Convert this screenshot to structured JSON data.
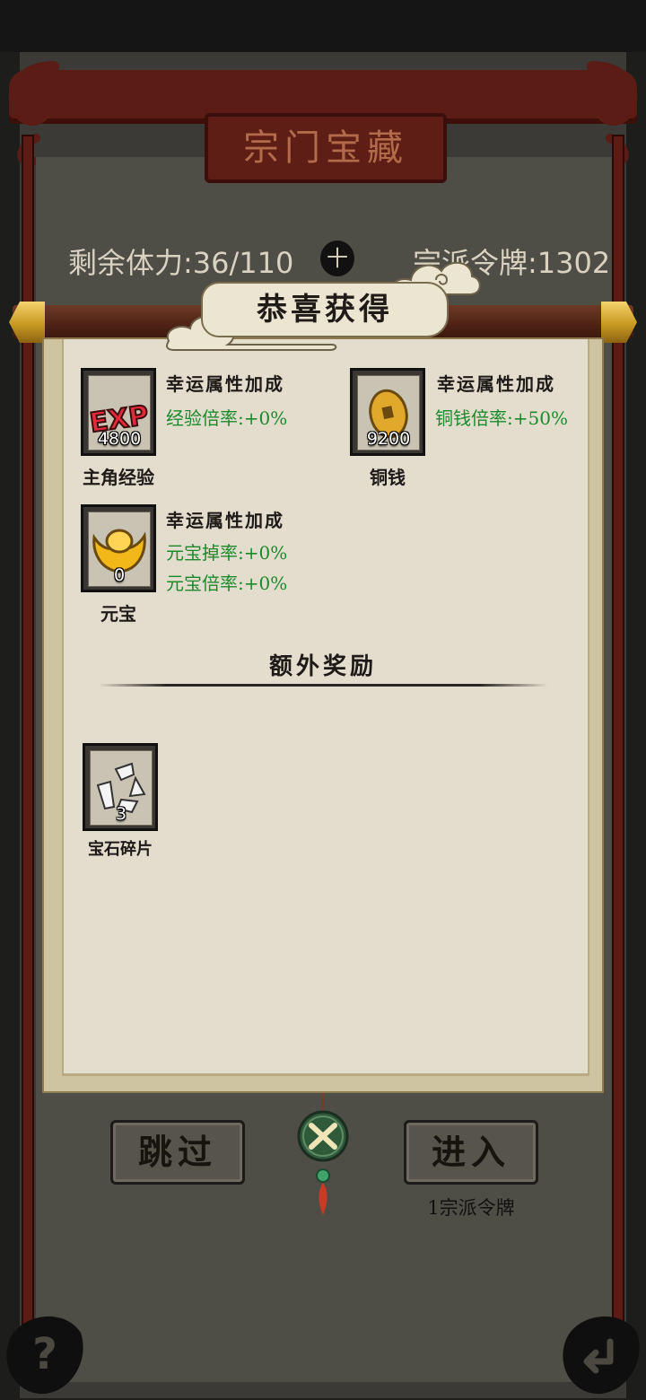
{
  "window": {
    "title": "宗门宝藏"
  },
  "stats": {
    "stamina_label": "剩余体力:36/110",
    "add_symbol": "十",
    "token_label": "宗派令牌:1302"
  },
  "reward_panel": {
    "title": "恭喜获得",
    "items": [
      {
        "name": "主角经验",
        "count": "4800",
        "icon": "exp-icon",
        "bonus_title": "幸运属性加成",
        "bonus_lines": [
          "经验倍率:+0%"
        ]
      },
      {
        "name": "铜钱",
        "count": "9200",
        "icon": "copper-coin-icon",
        "bonus_title": "幸运属性加成",
        "bonus_lines": [
          "铜钱倍率:+50%"
        ]
      },
      {
        "name": "元宝",
        "count": "0",
        "icon": "gold-ingot-icon",
        "bonus_title": "幸运属性加成",
        "bonus_lines": [
          "元宝掉率:+0%",
          "元宝倍率:+0%"
        ]
      }
    ],
    "extra_title": "额外奖励",
    "extra_items": [
      {
        "name": "宝石碎片",
        "count": "3",
        "icon": "gem-shards-icon"
      }
    ]
  },
  "actions": {
    "skip_label": "跳过",
    "enter_label": "进入",
    "enter_cost": "1宗派令牌",
    "close_icon": "crossed-swords-close-icon"
  },
  "corners": {
    "help_icon": "question-mark-icon",
    "back_icon": "return-arrow-icon"
  },
  "colors": {
    "bonus_green": "#1c8a2c",
    "frame_red": "#5a1c15",
    "paper": "#e3ddcd"
  }
}
